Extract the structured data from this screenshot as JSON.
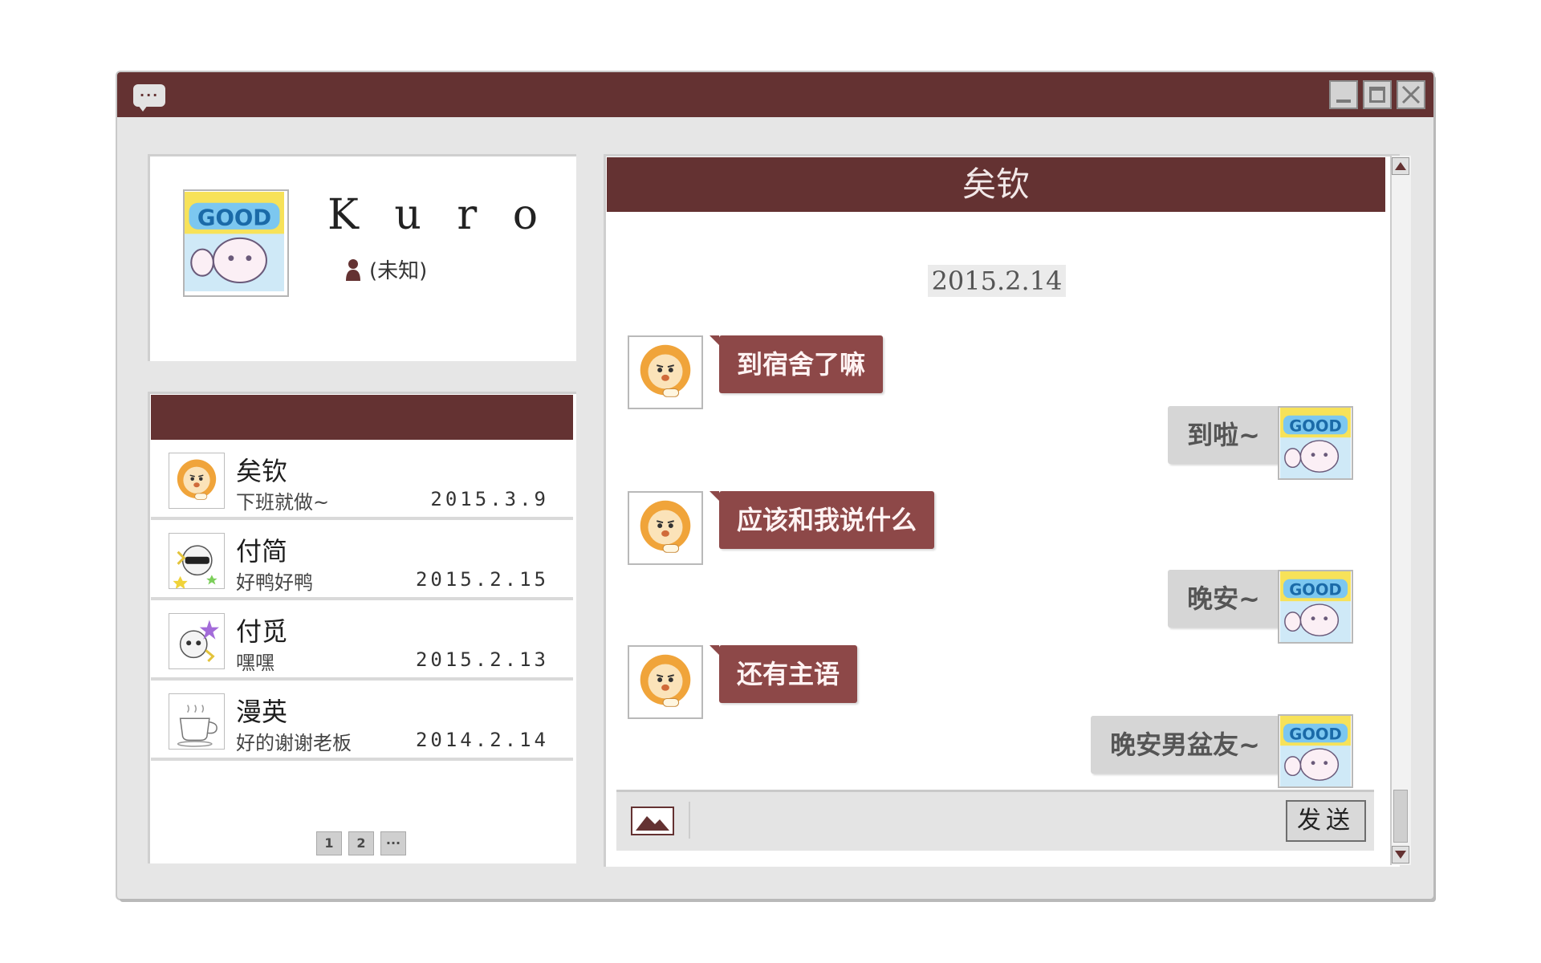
{
  "app": {
    "title_icon": "chat-bubble-icon",
    "window_controls": [
      "minimize-icon",
      "maximize-icon",
      "close-icon"
    ]
  },
  "profile": {
    "name": "K u r o",
    "status": "(未知)",
    "status_icon": "person-icon",
    "avatar_icon": "good-cat-sticker"
  },
  "contacts": {
    "items": [
      {
        "name": "矣钦",
        "last_message": "下班就做~",
        "date": "2015.3.9",
        "avatar": "lion-sticker"
      },
      {
        "name": "付简",
        "last_message": "好鸭好鸭",
        "date": "2015.2.15",
        "avatar": "sunglasses-skull-sticker"
      },
      {
        "name": "付觅",
        "last_message": "嘿嘿",
        "date": "2015.2.13",
        "avatar": "skull-star-sticker"
      },
      {
        "name": "漫英",
        "last_message": "好的谢谢老板",
        "date": "2014.2.14",
        "avatar": "coffee-cup-sticker"
      }
    ],
    "pager": [
      "1",
      "2",
      "···"
    ]
  },
  "chat": {
    "title": "矣钦",
    "date_separator": "2015.2.14",
    "messages": [
      {
        "from": "them",
        "text": "到宿舍了嘛"
      },
      {
        "from": "me",
        "text": "到啦~"
      },
      {
        "from": "them",
        "text": "应该和我说什么"
      },
      {
        "from": "me",
        "text": "晚安~"
      },
      {
        "from": "them",
        "text": "还有主语"
      },
      {
        "from": "me",
        "text": "晚安男盆友~"
      }
    ],
    "input_placeholder": "",
    "send_label": "发送",
    "image_button_icon": "image-icon"
  },
  "colors": {
    "accent": "#643232",
    "bubble_in": "#8d4848",
    "bubble_out": "#d6d6d6",
    "window_bg": "#e6e6e6"
  }
}
